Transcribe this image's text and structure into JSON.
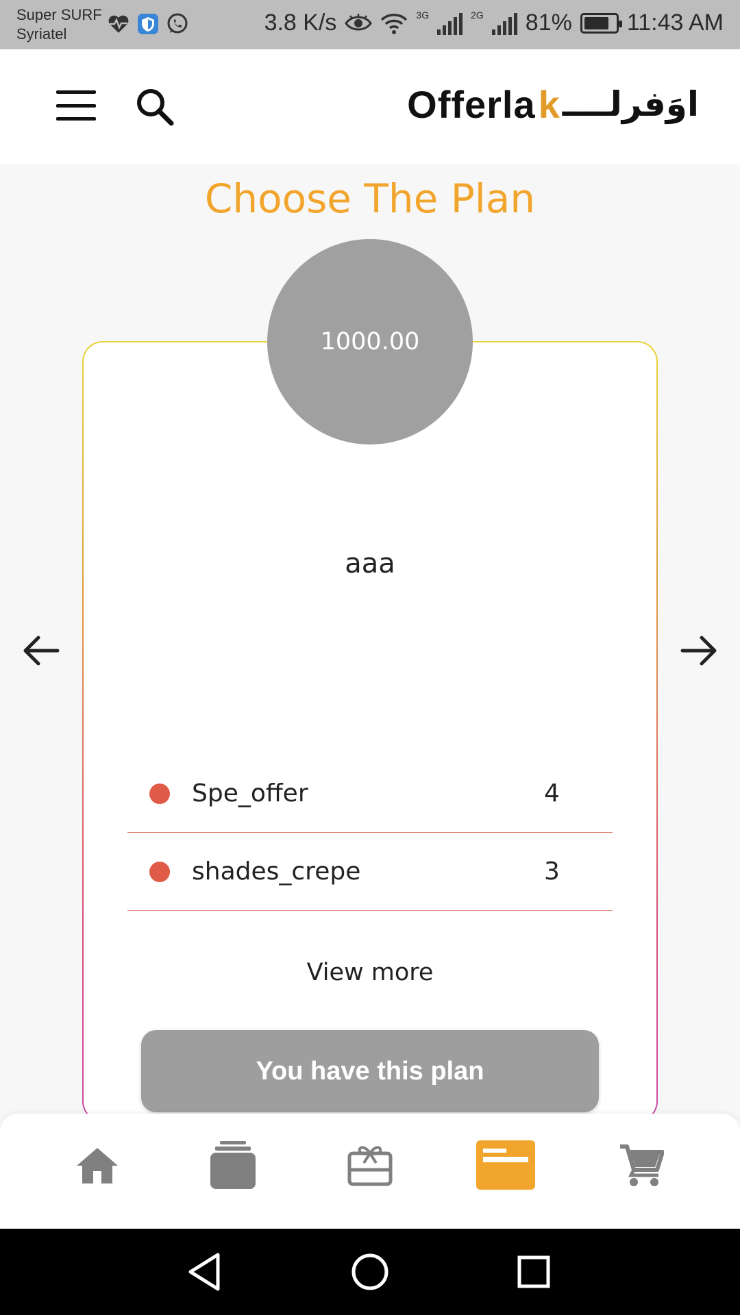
{
  "status_bar": {
    "carrier_line1": "Super SURF",
    "carrier_line2": "Syriatel",
    "speed": "3.8 K/s",
    "net_3g": "3G",
    "net_2g": "2G",
    "battery": "81%",
    "time": "11:43 AM"
  },
  "app_bar": {
    "logo_en": "Offerla",
    "logo_k": "k",
    "logo_ar": "اوَفرلــــ",
    "menu_icon": "menu-icon",
    "search_icon": "search-icon"
  },
  "page": {
    "title": "Choose The Plan"
  },
  "plan": {
    "price": "1000.00",
    "name": "aaa",
    "features": [
      {
        "name": "Spe_offer",
        "count": "4"
      },
      {
        "name": "shades_crepe",
        "count": "3"
      }
    ],
    "view_more": "View more",
    "button_label": "You have this plan"
  },
  "bottom_nav": {
    "items": [
      {
        "icon": "home-icon",
        "active": false
      },
      {
        "icon": "stack-icon",
        "active": false
      },
      {
        "icon": "gift-card-icon",
        "active": false
      },
      {
        "icon": "plan-card-icon",
        "active": true
      },
      {
        "icon": "cart-icon",
        "active": false
      }
    ]
  },
  "colors": {
    "accent": "#f2a52c",
    "inactive_icon": "#808080",
    "dot": "#e05b47",
    "circle": "#a0a0a0"
  }
}
